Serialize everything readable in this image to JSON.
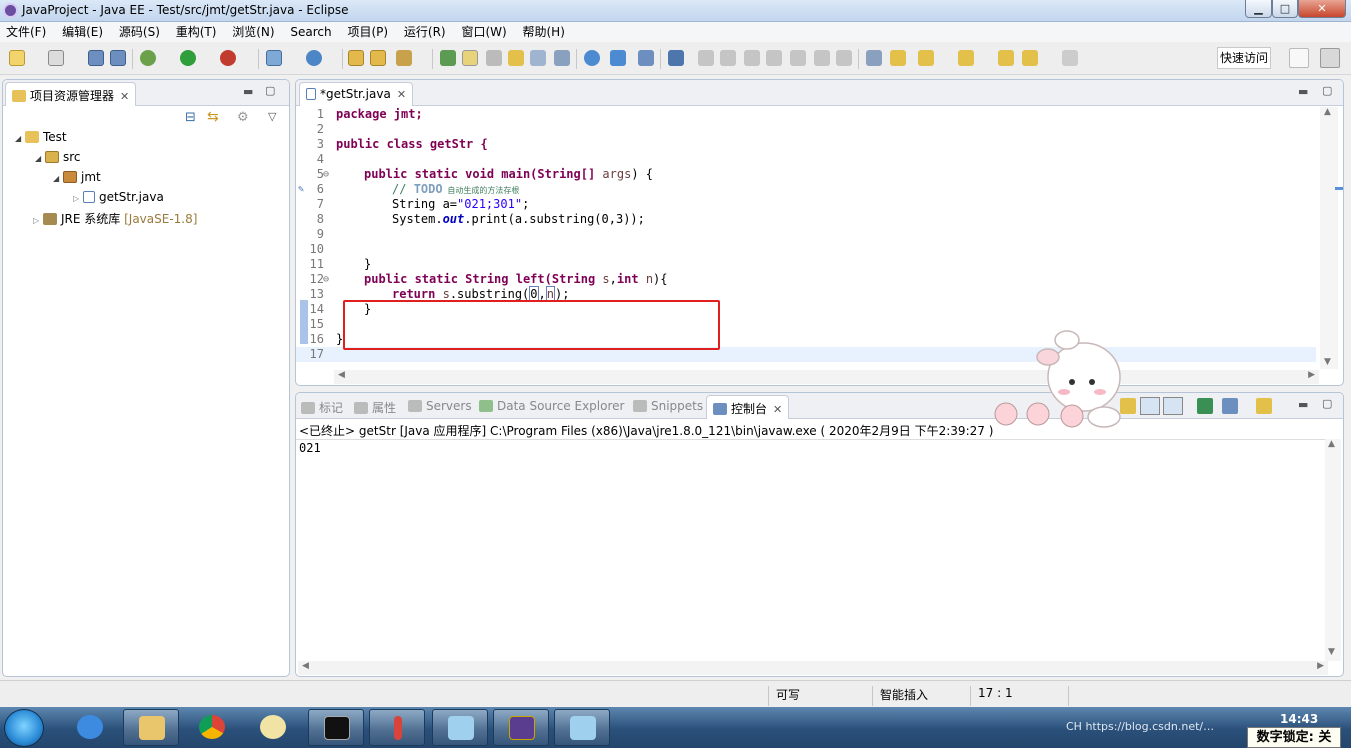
{
  "window": {
    "title": "JavaProject - Java EE - Test/src/jmt/getStr.java - Eclipse",
    "min": "▁",
    "max": "□",
    "close": "✕"
  },
  "menu": [
    "文件(F)",
    "编辑(E)",
    "源码(S)",
    "重构(T)",
    "浏览(N)",
    "Search",
    "项目(P)",
    "运行(R)",
    "窗口(W)",
    "帮助(H)"
  ],
  "toolbar": {
    "quick_access": "快速访问"
  },
  "explorer": {
    "title": "项目资源管理器",
    "tree": {
      "project": "Test",
      "src": "src",
      "package": "jmt",
      "file": "getStr.java",
      "jre": "JRE 系统库",
      "jre_version": "[JavaSE-1.8]"
    }
  },
  "editor": {
    "tab": "*getStr.java",
    "lines": [
      {
        "n": "1",
        "p": [
          "package jmt;"
        ]
      },
      {
        "n": "2"
      },
      {
        "n": "3",
        "p": [
          "public class getStr {"
        ]
      },
      {
        "n": "4"
      },
      {
        "n": "5",
        "p": [
          "public static void main(String[] ",
          "args",
          ") {"
        ]
      },
      {
        "n": "6",
        "p": [
          "// ",
          "TODO",
          " 自动生成的方法存根"
        ]
      },
      {
        "n": "7",
        "p": [
          "String a=",
          "\"021;301\"",
          ";"
        ]
      },
      {
        "n": "8",
        "p": [
          "System.",
          "out",
          ".print(a.substring(0,3));"
        ]
      },
      {
        "n": "9"
      },
      {
        "n": "10"
      },
      {
        "n": "11",
        "p": [
          "}"
        ]
      },
      {
        "n": "12",
        "p": [
          "public static String left(String ",
          "s",
          ",",
          "int",
          " ",
          "n",
          "){"
        ]
      },
      {
        "n": "13",
        "p": [
          "return ",
          "s",
          ".substring(",
          "0",
          ",",
          "n",
          ");"
        ]
      },
      {
        "n": "14",
        "p": [
          "}"
        ]
      },
      {
        "n": "15"
      },
      {
        "n": "16",
        "p": [
          "}"
        ]
      },
      {
        "n": "17"
      }
    ]
  },
  "console": {
    "tabs": [
      "标记",
      "属性",
      "Servers",
      "Data Source Explorer",
      "Snippets",
      "控制台"
    ],
    "path": "<已终止> getStr [Java 应用程序] C:\\Program Files (x86)\\Java\\jre1.8.0_121\\bin\\javaw.exe ( 2020年2月9日 下午2:39:27 )",
    "output": "021"
  },
  "status": {
    "writable": "可写",
    "insert": "智能插入",
    "position": "17 : 1"
  },
  "taskbar": {
    "tray_text": "CH  https://blog.csdn.net/…",
    "clock": "14:43",
    "numlock": "数字锁定: 关"
  }
}
